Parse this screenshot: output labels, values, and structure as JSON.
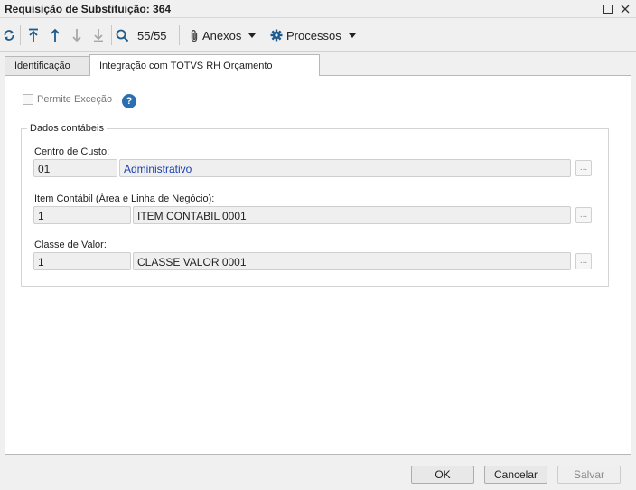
{
  "window": {
    "title": "Requisição de Substituição: 364"
  },
  "toolbar": {
    "record_counter": "55/55",
    "attachments_label": "Anexos",
    "processes_label": "Processos"
  },
  "tabs": [
    {
      "label": "Identificação",
      "active": false
    },
    {
      "label": "Integração com TOTVS RH Orçamento",
      "active": true
    }
  ],
  "form": {
    "exception_label": "Permite Exceção",
    "group_title": "Dados contábeis",
    "cost_center": {
      "label": "Centro de Custo:",
      "code": "01",
      "description": "Administrativo"
    },
    "accounting_item": {
      "label": "Item Contábil (Área e Linha de Negócio):",
      "code": "1",
      "description": "ITEM CONTABIL 0001"
    },
    "value_class": {
      "label": "Classe de Valor:",
      "code": "1",
      "description": "CLASSE VALOR 0001"
    },
    "lookup_label": "..."
  },
  "footer": {
    "ok_label": "OK",
    "cancel_label": "Cancelar",
    "save_label": "Salvar"
  },
  "colors": {
    "link_text": "#1a3fb0",
    "toolbar_icon": "#1e5a8a",
    "help_icon": "#2a6fb0"
  }
}
